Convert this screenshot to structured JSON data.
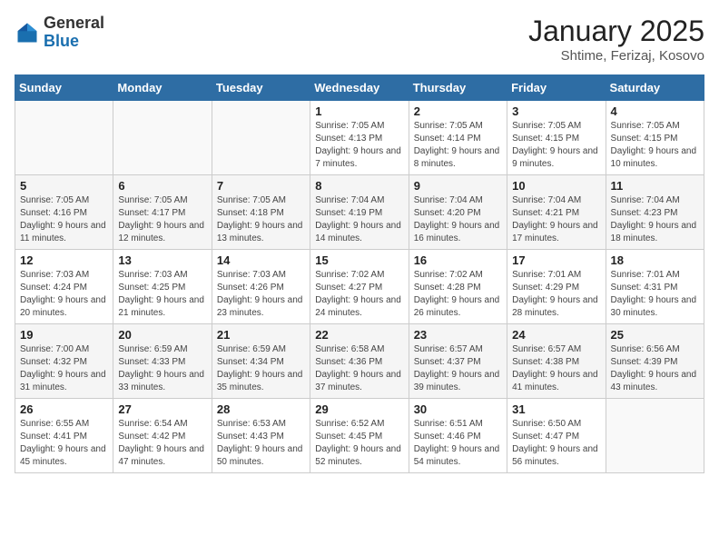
{
  "header": {
    "logo_general": "General",
    "logo_blue": "Blue",
    "month_title": "January 2025",
    "location": "Shtime, Ferizaj, Kosovo"
  },
  "days_of_week": [
    "Sunday",
    "Monday",
    "Tuesday",
    "Wednesday",
    "Thursday",
    "Friday",
    "Saturday"
  ],
  "weeks": [
    [
      {
        "day": null
      },
      {
        "day": null
      },
      {
        "day": null
      },
      {
        "day": 1,
        "sunrise": "7:05 AM",
        "sunset": "4:13 PM",
        "daylight": "9 hours and 7 minutes."
      },
      {
        "day": 2,
        "sunrise": "7:05 AM",
        "sunset": "4:14 PM",
        "daylight": "9 hours and 8 minutes."
      },
      {
        "day": 3,
        "sunrise": "7:05 AM",
        "sunset": "4:15 PM",
        "daylight": "9 hours and 9 minutes."
      },
      {
        "day": 4,
        "sunrise": "7:05 AM",
        "sunset": "4:15 PM",
        "daylight": "9 hours and 10 minutes."
      }
    ],
    [
      {
        "day": 5,
        "sunrise": "7:05 AM",
        "sunset": "4:16 PM",
        "daylight": "9 hours and 11 minutes."
      },
      {
        "day": 6,
        "sunrise": "7:05 AM",
        "sunset": "4:17 PM",
        "daylight": "9 hours and 12 minutes."
      },
      {
        "day": 7,
        "sunrise": "7:05 AM",
        "sunset": "4:18 PM",
        "daylight": "9 hours and 13 minutes."
      },
      {
        "day": 8,
        "sunrise": "7:04 AM",
        "sunset": "4:19 PM",
        "daylight": "9 hours and 14 minutes."
      },
      {
        "day": 9,
        "sunrise": "7:04 AM",
        "sunset": "4:20 PM",
        "daylight": "9 hours and 16 minutes."
      },
      {
        "day": 10,
        "sunrise": "7:04 AM",
        "sunset": "4:21 PM",
        "daylight": "9 hours and 17 minutes."
      },
      {
        "day": 11,
        "sunrise": "7:04 AM",
        "sunset": "4:23 PM",
        "daylight": "9 hours and 18 minutes."
      }
    ],
    [
      {
        "day": 12,
        "sunrise": "7:03 AM",
        "sunset": "4:24 PM",
        "daylight": "9 hours and 20 minutes."
      },
      {
        "day": 13,
        "sunrise": "7:03 AM",
        "sunset": "4:25 PM",
        "daylight": "9 hours and 21 minutes."
      },
      {
        "day": 14,
        "sunrise": "7:03 AM",
        "sunset": "4:26 PM",
        "daylight": "9 hours and 23 minutes."
      },
      {
        "day": 15,
        "sunrise": "7:02 AM",
        "sunset": "4:27 PM",
        "daylight": "9 hours and 24 minutes."
      },
      {
        "day": 16,
        "sunrise": "7:02 AM",
        "sunset": "4:28 PM",
        "daylight": "9 hours and 26 minutes."
      },
      {
        "day": 17,
        "sunrise": "7:01 AM",
        "sunset": "4:29 PM",
        "daylight": "9 hours and 28 minutes."
      },
      {
        "day": 18,
        "sunrise": "7:01 AM",
        "sunset": "4:31 PM",
        "daylight": "9 hours and 30 minutes."
      }
    ],
    [
      {
        "day": 19,
        "sunrise": "7:00 AM",
        "sunset": "4:32 PM",
        "daylight": "9 hours and 31 minutes."
      },
      {
        "day": 20,
        "sunrise": "6:59 AM",
        "sunset": "4:33 PM",
        "daylight": "9 hours and 33 minutes."
      },
      {
        "day": 21,
        "sunrise": "6:59 AM",
        "sunset": "4:34 PM",
        "daylight": "9 hours and 35 minutes."
      },
      {
        "day": 22,
        "sunrise": "6:58 AM",
        "sunset": "4:36 PM",
        "daylight": "9 hours and 37 minutes."
      },
      {
        "day": 23,
        "sunrise": "6:57 AM",
        "sunset": "4:37 PM",
        "daylight": "9 hours and 39 minutes."
      },
      {
        "day": 24,
        "sunrise": "6:57 AM",
        "sunset": "4:38 PM",
        "daylight": "9 hours and 41 minutes."
      },
      {
        "day": 25,
        "sunrise": "6:56 AM",
        "sunset": "4:39 PM",
        "daylight": "9 hours and 43 minutes."
      }
    ],
    [
      {
        "day": 26,
        "sunrise": "6:55 AM",
        "sunset": "4:41 PM",
        "daylight": "9 hours and 45 minutes."
      },
      {
        "day": 27,
        "sunrise": "6:54 AM",
        "sunset": "4:42 PM",
        "daylight": "9 hours and 47 minutes."
      },
      {
        "day": 28,
        "sunrise": "6:53 AM",
        "sunset": "4:43 PM",
        "daylight": "9 hours and 50 minutes."
      },
      {
        "day": 29,
        "sunrise": "6:52 AM",
        "sunset": "4:45 PM",
        "daylight": "9 hours and 52 minutes."
      },
      {
        "day": 30,
        "sunrise": "6:51 AM",
        "sunset": "4:46 PM",
        "daylight": "9 hours and 54 minutes."
      },
      {
        "day": 31,
        "sunrise": "6:50 AM",
        "sunset": "4:47 PM",
        "daylight": "9 hours and 56 minutes."
      },
      {
        "day": null
      }
    ]
  ]
}
